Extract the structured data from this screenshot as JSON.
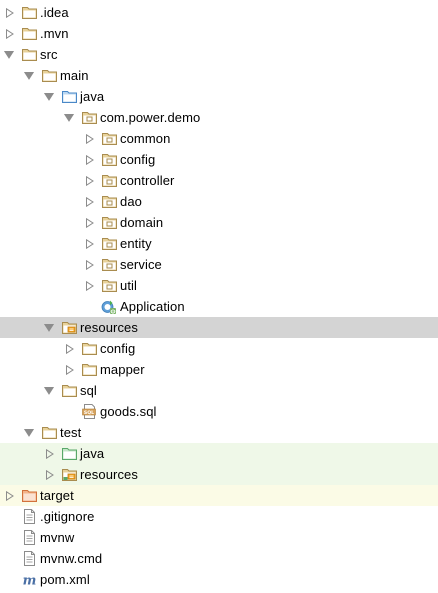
{
  "project_tree": {
    "colors": {
      "selected_bg": "#d4d4d4",
      "test_bg": "#eff8e8",
      "excluded_bg": "#fbfbe6",
      "folder": "#a98c4f",
      "source_folder": "#4a88c7",
      "test_folder": "#59a869",
      "arrow": "#8c8c8c"
    },
    "items": [
      {
        "name": "tree-item-idea",
        "label": ".idea",
        "depth": 0,
        "expand": "collapsed",
        "icon": "folder-icon"
      },
      {
        "name": "tree-item-mvn",
        "label": ".mvn",
        "depth": 0,
        "expand": "collapsed",
        "icon": "folder-icon"
      },
      {
        "name": "tree-item-src",
        "label": "src",
        "depth": 0,
        "expand": "expanded",
        "icon": "folder-icon"
      },
      {
        "name": "tree-item-main",
        "label": "main",
        "depth": 1,
        "expand": "expanded",
        "icon": "folder-icon"
      },
      {
        "name": "tree-item-java",
        "label": "java",
        "depth": 2,
        "expand": "expanded",
        "icon": "source-folder-icon"
      },
      {
        "name": "tree-item-com-power-demo",
        "label": "com.power.demo",
        "depth": 3,
        "expand": "expanded",
        "icon": "package-icon"
      },
      {
        "name": "tree-item-common",
        "label": "common",
        "depth": 4,
        "expand": "collapsed",
        "icon": "package-icon"
      },
      {
        "name": "tree-item-config",
        "label": "config",
        "depth": 4,
        "expand": "collapsed",
        "icon": "package-icon"
      },
      {
        "name": "tree-item-controller",
        "label": "controller",
        "depth": 4,
        "expand": "collapsed",
        "icon": "package-icon"
      },
      {
        "name": "tree-item-dao",
        "label": "dao",
        "depth": 4,
        "expand": "collapsed",
        "icon": "package-icon"
      },
      {
        "name": "tree-item-domain",
        "label": "domain",
        "depth": 4,
        "expand": "collapsed",
        "icon": "package-icon"
      },
      {
        "name": "tree-item-entity",
        "label": "entity",
        "depth": 4,
        "expand": "collapsed",
        "icon": "package-icon"
      },
      {
        "name": "tree-item-service",
        "label": "service",
        "depth": 4,
        "expand": "collapsed",
        "icon": "package-icon"
      },
      {
        "name": "tree-item-util",
        "label": "util",
        "depth": 4,
        "expand": "collapsed",
        "icon": "package-icon"
      },
      {
        "name": "tree-item-application",
        "label": "Application",
        "depth": 4,
        "expand": "none",
        "icon": "spring-boot-class-icon"
      },
      {
        "name": "tree-item-resources",
        "label": "resources",
        "depth": 2,
        "expand": "expanded",
        "icon": "resources-folder-icon",
        "selected": true
      },
      {
        "name": "tree-item-resources-config",
        "label": "config",
        "depth": 3,
        "expand": "collapsed",
        "icon": "folder-icon"
      },
      {
        "name": "tree-item-mapper",
        "label": "mapper",
        "depth": 3,
        "expand": "collapsed",
        "icon": "folder-icon"
      },
      {
        "name": "tree-item-sql",
        "label": "sql",
        "depth": 2,
        "expand": "expanded",
        "icon": "folder-icon"
      },
      {
        "name": "tree-item-goods-sql",
        "label": "goods.sql",
        "depth": 3,
        "expand": "none",
        "icon": "sql-file-icon"
      },
      {
        "name": "tree-item-test",
        "label": "test",
        "depth": 1,
        "expand": "expanded",
        "icon": "folder-icon"
      },
      {
        "name": "tree-item-test-java",
        "label": "java",
        "depth": 2,
        "expand": "collapsed",
        "icon": "test-source-folder-icon",
        "highlight": "test"
      },
      {
        "name": "tree-item-test-resources",
        "label": "resources",
        "depth": 2,
        "expand": "collapsed",
        "icon": "test-resources-folder-icon",
        "highlight": "test"
      },
      {
        "name": "tree-item-target",
        "label": "target",
        "depth": 0,
        "expand": "collapsed",
        "icon": "excluded-folder-icon",
        "highlight": "excluded"
      },
      {
        "name": "tree-item-gitignore",
        "label": ".gitignore",
        "depth": 0,
        "expand": "none",
        "icon": "text-file-icon"
      },
      {
        "name": "tree-item-mvnw",
        "label": "mvnw",
        "depth": 0,
        "expand": "none",
        "icon": "text-file-icon"
      },
      {
        "name": "tree-item-mvnw-cmd",
        "label": "mvnw.cmd",
        "depth": 0,
        "expand": "none",
        "icon": "text-file-icon"
      },
      {
        "name": "tree-item-pom-xml",
        "label": "pom.xml",
        "depth": 0,
        "expand": "none",
        "icon": "maven-file-icon"
      }
    ]
  }
}
